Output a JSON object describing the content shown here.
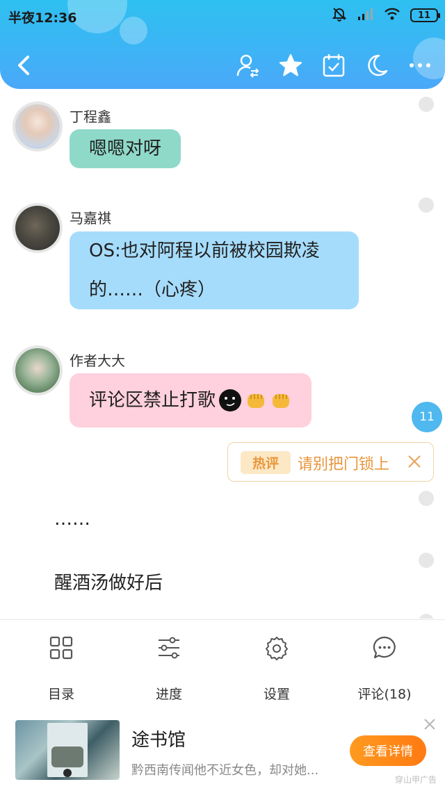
{
  "status_bar": {
    "time": "半夜12:36",
    "battery": "11"
  },
  "nav": {
    "back_icon": "chevron-left-icon",
    "icons": [
      "character-switch-icon",
      "star-icon",
      "calendar-check-icon",
      "moon-icon",
      "more-icon"
    ]
  },
  "messages": [
    {
      "name": "丁程鑫",
      "text": "嗯嗯对呀",
      "bubble_color": "#8fd9c9"
    },
    {
      "name": "马嘉祺",
      "lines": [
        "OS:也对阿程以前被校园欺凌",
        "的……（心疼）"
      ],
      "bubble_color": "#a6dcfb"
    },
    {
      "name": "作者大大",
      "text": "评论区禁止打歌",
      "bubble_color": "#ffd0dd"
    }
  ],
  "comment_count": "11",
  "hot_comment": {
    "tag": "热评",
    "text": "请别把门锁上"
  },
  "narration": [
    "……",
    "醒酒汤做好后"
  ],
  "toolbar": [
    {
      "label": "目录",
      "icon": "catalog-grid-icon"
    },
    {
      "label": "进度",
      "icon": "progress-sliders-icon"
    },
    {
      "label": "设置",
      "icon": "settings-gear-icon"
    },
    {
      "label": "评论(18)",
      "icon": "comment-bubble-icon"
    }
  ],
  "ad": {
    "title": "途书馆",
    "description": "黔西南传闻他不近女色，却对她...",
    "button": "查看详情",
    "source": "穿山甲广告"
  }
}
